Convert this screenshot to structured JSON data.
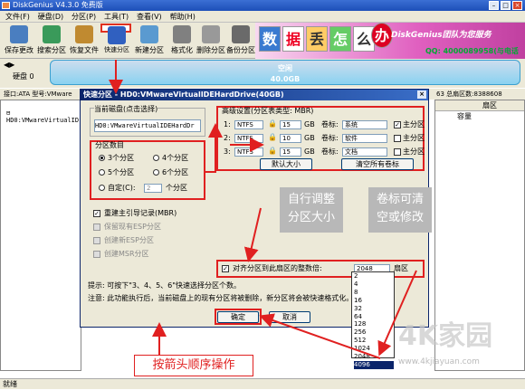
{
  "window": {
    "title": "DiskGenius V4.3.0 免费版",
    "minimize": "–",
    "maximize": "□",
    "close": "×"
  },
  "menu": [
    "文件(F)",
    "硬盘(D)",
    "分区(P)",
    "工具(T)",
    "查看(V)",
    "帮助(H)"
  ],
  "toolbar": [
    {
      "label": "保存更改",
      "icon": "save-icon",
      "color": "#4a7ec0"
    },
    {
      "label": "搜索分区",
      "icon": "search-icon",
      "color": "#3a9a5a"
    },
    {
      "label": "恢复文件",
      "icon": "restore-icon",
      "color": "#c08a30"
    },
    {
      "label": "快速分区",
      "icon": "quick-partition-icon",
      "color": "#3060c0"
    },
    {
      "label": "新建分区",
      "icon": "new-partition-icon",
      "color": "#5a9ad0"
    },
    {
      "label": "格式化",
      "icon": "format-icon",
      "color": "#808080"
    },
    {
      "label": "删除分区",
      "icon": "delete-icon",
      "color": "#999"
    },
    {
      "label": "备份分区",
      "icon": "backup-icon",
      "color": "#6a6a6a"
    }
  ],
  "banner": {
    "cards": [
      "数",
      "据",
      "丢",
      "怎",
      "么",
      "办"
    ],
    "brand": "DiskGenius团队为您服务",
    "qq": "QQ: 4000089958(与电话",
    "phone": "话: 400-008-"
  },
  "disk": {
    "label": "硬盘 0",
    "bar_line1": "空闲",
    "bar_line2": "40.0GB"
  },
  "infobar": "接口:ATA 型号:VMware",
  "infobar_right": "63 总扇区数:8388608",
  "tree": {
    "root": "HD0:VMwareVirtualID"
  },
  "grid": {
    "col1": "扇区",
    "col2": "容量"
  },
  "statusbar": "就绪",
  "dialog": {
    "title": "快速分区 - HD0:VMwareVirtualIDEHardDrive(40GB)",
    "current_disk_label": "当前磁盘(点击选择)",
    "current_disk_value": "HD0:VMwareVirtualIDEHardDr",
    "count_group": "分区数目",
    "counts": [
      {
        "label": "3个分区",
        "on": true
      },
      {
        "label": "4个分区",
        "on": false
      },
      {
        "label": "5个分区",
        "on": false
      },
      {
        "label": "6个分区",
        "on": false
      }
    ],
    "custom_label": "自定(C):",
    "custom_value": "2",
    "custom_unit": "个分区",
    "rebuild_mbr": "重建主引导记录(MBR)",
    "keep_esp": "保留现有ESP分区",
    "create_esp": "创建新ESP分区",
    "create_msr": "创建MSR分区",
    "adv_title": "高级设置(分区表类型: MBR)",
    "rows": [
      {
        "num": "1:",
        "fs": "NTFS",
        "size": "15",
        "unit": "GB",
        "vol_label": "卷标:",
        "vol": "系统",
        "primary": "主分区",
        "primary_on": true
      },
      {
        "num": "2:",
        "fs": "NTFS",
        "size": "10",
        "unit": "GB",
        "vol_label": "卷标:",
        "vol": "软件",
        "primary": "主分区",
        "primary_on": false
      },
      {
        "num": "3:",
        "fs": "NTFS",
        "size": "15",
        "unit": "GB",
        "vol_label": "卷标:",
        "vol": "文档",
        "primary": "主分区",
        "primary_on": false
      }
    ],
    "default_size": "默认大小",
    "clear_labels": "清空所有卷标",
    "annot_size": "自行调整\n分区大小",
    "annot_label": "卷标可清\n空或修改",
    "align_label": "对齐分区到此扇区的整数倍:",
    "align_value": "2048",
    "align_unit": "扇区",
    "tip": "提示: 可按下\"3、4、5、6\"快速选择分区个数。",
    "warn": "注意: 此功能执行后，当前磁盘上的现有分区将被删除，新分区将会被快速格式化。",
    "ok": "确定",
    "cancel": "取消"
  },
  "dropdown": [
    "2",
    "4",
    "8",
    "16",
    "32",
    "64",
    "128",
    "256",
    "512",
    "1024",
    "2048",
    "4096"
  ],
  "dropdown_selected": "4096",
  "action_note": "按箭头顺序操作",
  "watermark": {
    "brand": "4K家园",
    "sub": "www.4kjiayuan.com"
  }
}
